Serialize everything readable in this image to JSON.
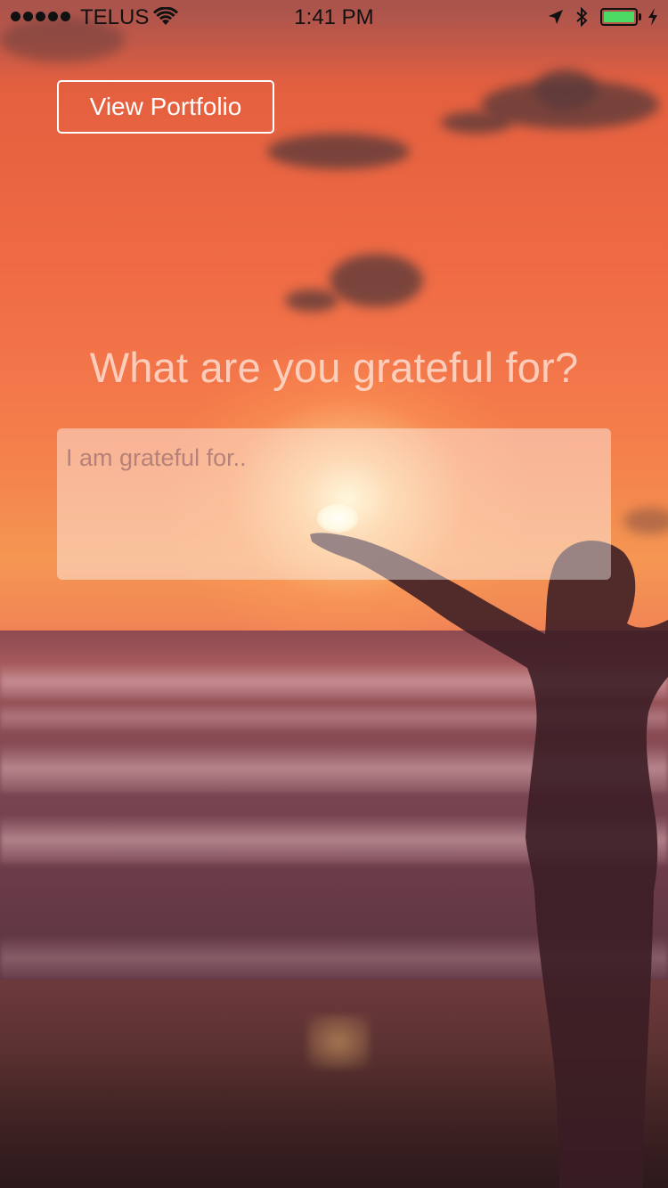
{
  "status_bar": {
    "carrier": "TELUS",
    "time": "1:41 PM",
    "battery_color": "#4cd964",
    "icons": [
      "signal-dots-icon",
      "wifi-icon",
      "location-arrow-icon",
      "bluetooth-icon",
      "battery-icon",
      "charging-bolt-icon"
    ]
  },
  "header": {
    "portfolio_button_label": "View Portfolio"
  },
  "main": {
    "question": "What are you grateful for?",
    "answer_placeholder": "I am grateful for..",
    "answer_value": ""
  },
  "background": {
    "scene": "sunset-beach-photo"
  }
}
